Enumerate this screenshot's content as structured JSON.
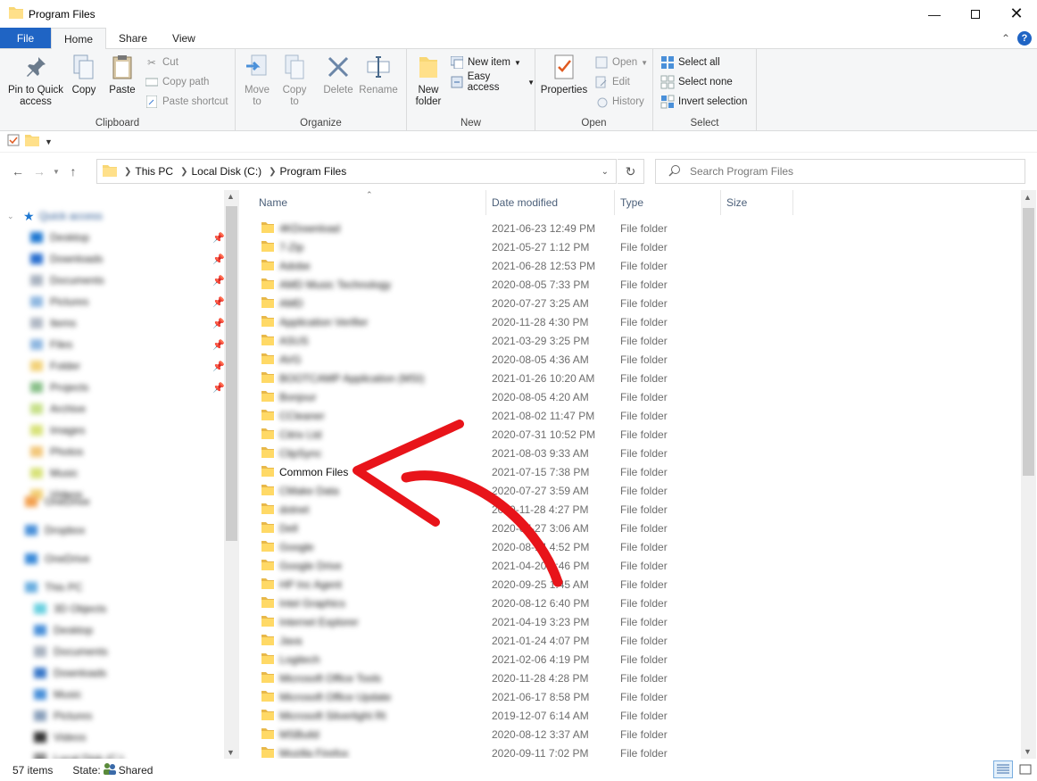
{
  "window": {
    "title": "Program Files"
  },
  "tabs": {
    "file": "File",
    "home": "Home",
    "share": "Share",
    "view": "View"
  },
  "ribbon": {
    "clipboard": {
      "label": "Clipboard",
      "pin": "Pin to Quick access",
      "copy": "Copy",
      "paste": "Paste",
      "cut": "Cut",
      "copy_path": "Copy path",
      "paste_shortcut": "Paste shortcut"
    },
    "organize": {
      "label": "Organize",
      "move_to": "Move to",
      "copy_to": "Copy to",
      "delete": "Delete",
      "rename": "Rename"
    },
    "new": {
      "label": "New",
      "new_folder": "New folder",
      "new_item": "New item",
      "easy_access": "Easy access"
    },
    "open": {
      "label": "Open",
      "properties": "Properties",
      "open": "Open",
      "edit": "Edit",
      "history": "History"
    },
    "select": {
      "label": "Select",
      "select_all": "Select all",
      "select_none": "Select none",
      "invert": "Invert selection"
    }
  },
  "address": {
    "crumbs": [
      "This PC",
      "Local Disk (C:)",
      "Program Files"
    ]
  },
  "search": {
    "placeholder": "Search Program Files"
  },
  "columns": {
    "name": "Name",
    "date": "Date modified",
    "type": "Type",
    "size": "Size"
  },
  "nav": {
    "quick_access": "Quick access",
    "items": [
      "Desktop",
      "Downloads",
      "Documents",
      "Pictures",
      "Items",
      "Files",
      "Folder",
      "Projects",
      "Archive",
      "Images",
      "Photos",
      "Music",
      "Videos"
    ],
    "bottom": [
      "OneDrive",
      "Dropbox",
      "OneDrive",
      "This PC",
      "3D Objects",
      "Desktop",
      "Documents",
      "Downloads",
      "Music",
      "Pictures",
      "Videos",
      "Local Disk (C:)"
    ]
  },
  "files": [
    {
      "name": "",
      "date": "2021-06-23 12:49 PM",
      "type": "File folder"
    },
    {
      "name": "",
      "date": "2021-05-27 1:12 PM",
      "type": "File folder"
    },
    {
      "name": "",
      "date": "2021-06-28 12:53 PM",
      "type": "File folder"
    },
    {
      "name": "",
      "date": "2020-08-05 7:33 PM",
      "type": "File folder"
    },
    {
      "name": "",
      "date": "2020-07-27 3:25 AM",
      "type": "File folder"
    },
    {
      "name": "",
      "date": "2020-11-28 4:30 PM",
      "type": "File folder"
    },
    {
      "name": "",
      "date": "2021-03-29 3:25 PM",
      "type": "File folder"
    },
    {
      "name": "",
      "date": "2020-08-05 4:36 AM",
      "type": "File folder"
    },
    {
      "name": "",
      "date": "2021-01-26 10:20 AM",
      "type": "File folder"
    },
    {
      "name": "",
      "date": "2020-08-05 4:20 AM",
      "type": "File folder"
    },
    {
      "name": "",
      "date": "2021-08-02 11:47 PM",
      "type": "File folder"
    },
    {
      "name": "",
      "date": "2020-07-31 10:52 PM",
      "type": "File folder"
    },
    {
      "name": "",
      "date": "2021-08-03 9:33 AM",
      "type": "File folder"
    },
    {
      "name": "Common Files",
      "date": "2021-07-15 7:38 PM",
      "type": "File folder"
    },
    {
      "name": "",
      "date": "2020-07-27 3:59 AM",
      "type": "File folder"
    },
    {
      "name": "",
      "date": "2020-11-28 4:27 PM",
      "type": "File folder"
    },
    {
      "name": "",
      "date": "2020-07-27 3:06 AM",
      "type": "File folder"
    },
    {
      "name": "",
      "date": "2020-08-14 4:52 PM",
      "type": "File folder"
    },
    {
      "name": "",
      "date": "2021-04-20 4:46 PM",
      "type": "File folder"
    },
    {
      "name": "",
      "date": "2020-09-25 1:45 AM",
      "type": "File folder"
    },
    {
      "name": "",
      "date": "2020-08-12 6:40 PM",
      "type": "File folder"
    },
    {
      "name": "",
      "date": "2021-04-19 3:23 PM",
      "type": "File folder"
    },
    {
      "name": "",
      "date": "2021-01-24 4:07 PM",
      "type": "File folder"
    },
    {
      "name": "",
      "date": "2021-02-06 4:19 PM",
      "type": "File folder"
    },
    {
      "name": "",
      "date": "2020-11-28 4:28 PM",
      "type": "File folder"
    },
    {
      "name": "",
      "date": "2021-06-17 8:58 PM",
      "type": "File folder"
    },
    {
      "name": "",
      "date": "2019-12-07 6:14 AM",
      "type": "File folder"
    },
    {
      "name": "",
      "date": "2020-08-12 3:37 AM",
      "type": "File folder"
    },
    {
      "name": "",
      "date": "2020-09-11 7:02 PM",
      "type": "File folder"
    }
  ],
  "blurred_names": [
    "4KDownload",
    "7-Zip",
    "Adobe",
    "AMD Music Technology",
    "AMD",
    "Application Verifier",
    "ASUS",
    "AVG",
    "BOOTCAMP Application (MSI)",
    "Bonjour",
    "CCleaner",
    "Citrix Ltd",
    "ClipSync",
    "",
    "CMake Data",
    "dotnet",
    "Dell",
    "Google",
    "Google Drive",
    "HP Inc Agent",
    "Intel Graphics",
    "Internet Explorer",
    "Java",
    "Logitech",
    "Microsoft Office Tools",
    "Microsoft Office Update",
    "Microsoft Silverlight Rt",
    "MSBuild",
    "Mozilla Firefox"
  ],
  "status": {
    "items": "57 items",
    "state_label": "State:",
    "state_value": "Shared"
  }
}
